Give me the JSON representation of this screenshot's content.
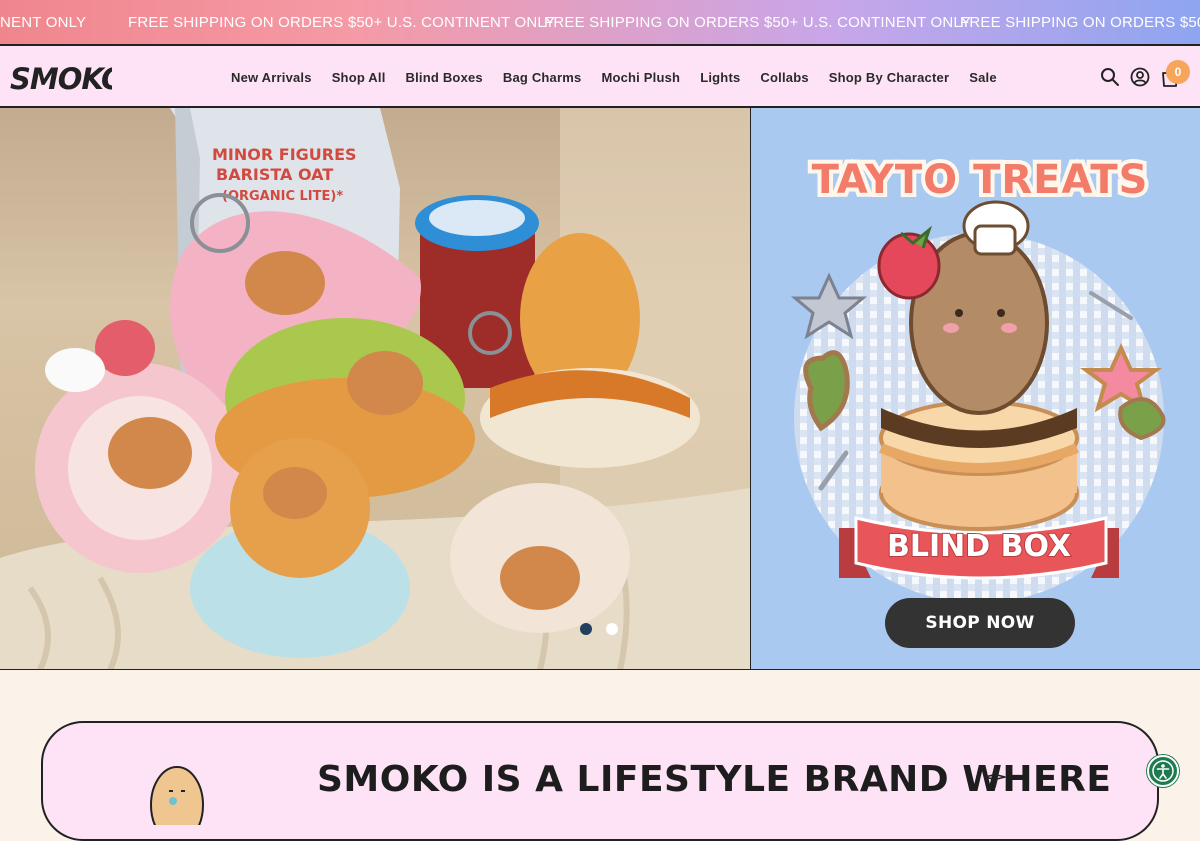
{
  "announcement": {
    "text": "FREE SHIPPING ON ORDERS $50+ U.S. CONTINENT ONLY",
    "fragment_left": "NENT ONLY"
  },
  "header": {
    "logo_text": "SMOKO",
    "nav": [
      {
        "label": "New Arrivals"
      },
      {
        "label": "Shop All"
      },
      {
        "label": "Blind Boxes"
      },
      {
        "label": "Bag Charms"
      },
      {
        "label": "Mochi Plush"
      },
      {
        "label": "Lights"
      },
      {
        "label": "Collabs"
      },
      {
        "label": "Shop By Character"
      },
      {
        "label": "Sale"
      }
    ],
    "cart_count": "0"
  },
  "hero": {
    "photo_text": {
      "carton_line1": "MINOR FIGURES",
      "carton_line2": "BARISTA OAT",
      "carton_line3": "(ORGANIC LITE)*"
    },
    "promo": {
      "title": "TAYTO TREATS",
      "ribbon": "BLIND BOX",
      "cta": "SHOP NOW"
    },
    "slides": {
      "total": 2,
      "active": 1
    }
  },
  "about": {
    "heading": "SMOKO IS A LIFESTYLE BRAND WHERE"
  },
  "colors": {
    "header_bg": "#fde3f5",
    "page_bg": "#fbf3ea",
    "promo_bg": "#a9c9f1",
    "cta_bg": "#333333",
    "cart_badge": "#f7a55b",
    "ribbon": "#e8565a"
  }
}
